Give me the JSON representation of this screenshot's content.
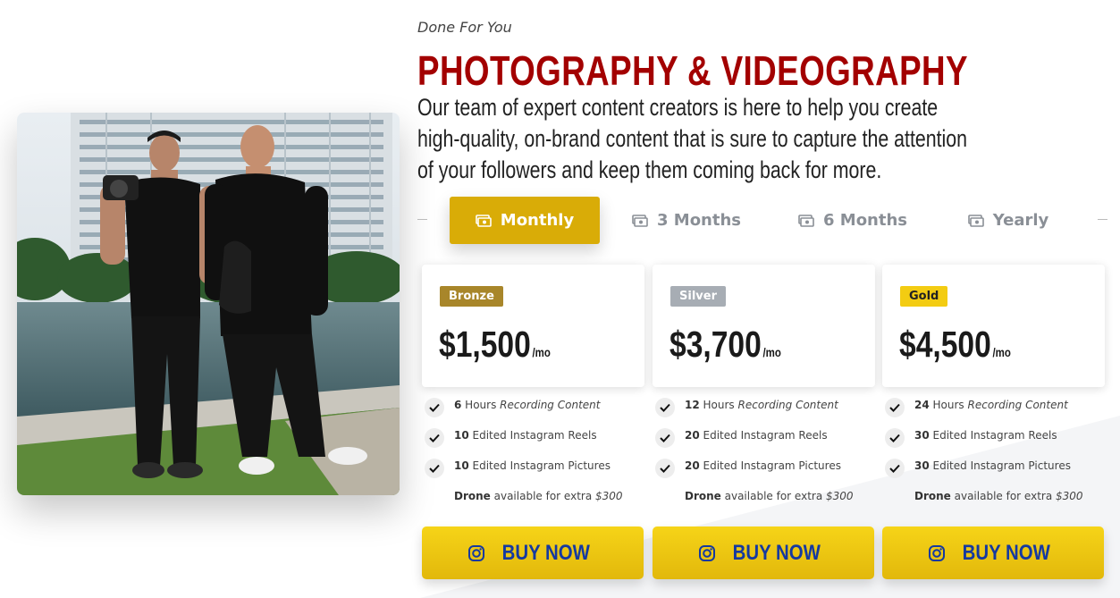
{
  "hero": {
    "eyebrow": "Done For You",
    "title": "PHOTOGRAPHY & VIDEOGRAPHY",
    "description": "Our team of expert content creators is here to help you create high-quality, on-brand content that is sure to capture the attention of your followers and keep them coming back for more."
  },
  "tabs": [
    {
      "label": "Monthly",
      "active": true,
      "icon": "money-icon"
    },
    {
      "label": "3 Months",
      "active": false,
      "icon": "money-icon"
    },
    {
      "label": "6 Months",
      "active": false,
      "icon": "money-icon"
    },
    {
      "label": "Yearly",
      "active": false,
      "icon": "money-icon"
    }
  ],
  "plans": [
    {
      "tier": "Bronze",
      "tier_color": "#a8862a",
      "price": "$1,500",
      "period": "/mo",
      "features": [
        {
          "num": "6",
          "text": " Hours ",
          "italic": "Recording Content"
        },
        {
          "num": "10",
          "text": " Edited Instagram Reels",
          "italic": ""
        },
        {
          "num": "10",
          "text": " Edited Instagram Pictures",
          "italic": ""
        }
      ],
      "drone": {
        "bold": "Drone",
        "text": " available for extra ",
        "price": "$300"
      },
      "cta": "BUY NOW"
    },
    {
      "tier": "Silver",
      "tier_color": "#a7adb4",
      "price": "$3,700",
      "period": "/mo",
      "features": [
        {
          "num": "12",
          "text": " Hours ",
          "italic": "Recording Content"
        },
        {
          "num": "20",
          "text": " Edited Instagram Reels",
          "italic": ""
        },
        {
          "num": "20",
          "text": " Edited Instagram Pictures",
          "italic": ""
        }
      ],
      "drone": {
        "bold": "Drone",
        "text": " available for extra ",
        "price": "$300"
      },
      "cta": "BUY NOW"
    },
    {
      "tier": "Gold",
      "tier_color": "#f3cc12",
      "price": "$4,500",
      "period": "/mo",
      "features": [
        {
          "num": "24",
          "text": " Hours ",
          "italic": "Recording Content"
        },
        {
          "num": "30",
          "text": " Edited Instagram Reels",
          "italic": ""
        },
        {
          "num": "30",
          "text": " Edited Instagram Pictures",
          "italic": ""
        }
      ],
      "drone": {
        "bold": "Drone",
        "text": " available for extra ",
        "price": "$300"
      },
      "cta": "BUY NOW"
    }
  ],
  "colors": {
    "title": "#a30000",
    "tab_active": "#d9ac07",
    "cta_bg": "#f0c80f",
    "cta_text": "#1539a0"
  },
  "icons": {
    "feature": "check-icon",
    "cta": "instagram-icon"
  }
}
